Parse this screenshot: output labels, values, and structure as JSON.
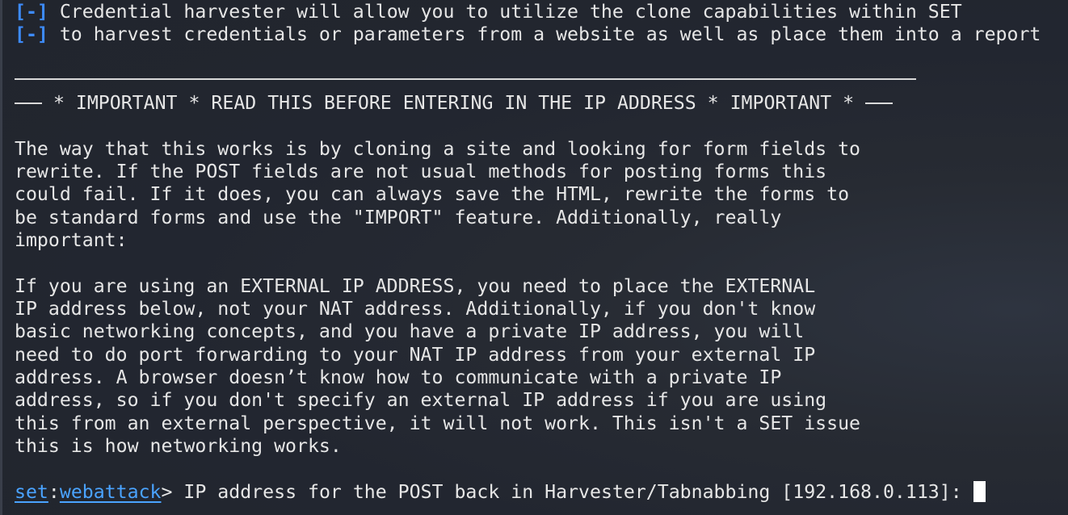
{
  "terminal": {
    "intro": [
      {
        "marker": "[-]",
        "text": " Credential harvester will allow you to utilize the clone capabilities within SET"
      },
      {
        "marker": "[-]",
        "text": " to harvest credentials or parameters from a website as well as place them into a report"
      }
    ],
    "important_banner": " * IMPORTANT * READ THIS BEFORE ENTERING IN THE IP ADDRESS * IMPORTANT * ",
    "paragraph1": [
      "The way that this works is by cloning a site and looking for form fields to",
      "rewrite. If the POST fields are not usual methods for posting forms this",
      "could fail. If it does, you can always save the HTML, rewrite the forms to",
      "be standard forms and use the \"IMPORT\" feature. Additionally, really",
      "important:"
    ],
    "paragraph2": [
      "If you are using an EXTERNAL IP ADDRESS, you need to place the EXTERNAL",
      "IP address below, not your NAT address. Additionally, if you don't know",
      "basic networking concepts, and you have a private IP address, you will",
      "need to do port forwarding to your NAT IP address from your external IP",
      "address. A browser doesn’t know how to communicate with a private IP",
      "address, so if you don't specify an external IP address if you are using",
      "this from an external perspective, it will not work. This isn't a SET issue",
      "this is how networking works."
    ],
    "prompt": {
      "set": "set",
      "colon": ":",
      "module": "webattack",
      "gt": ">",
      "question": " IP address for the POST back in Harvester/Tabnabbing [192.168.0.113]: "
    }
  },
  "colors": {
    "background": "#23272f",
    "text": "#e6e6e6",
    "accent_blue": "#3d8bfd",
    "prompt_blue": "#4aa3ff"
  }
}
